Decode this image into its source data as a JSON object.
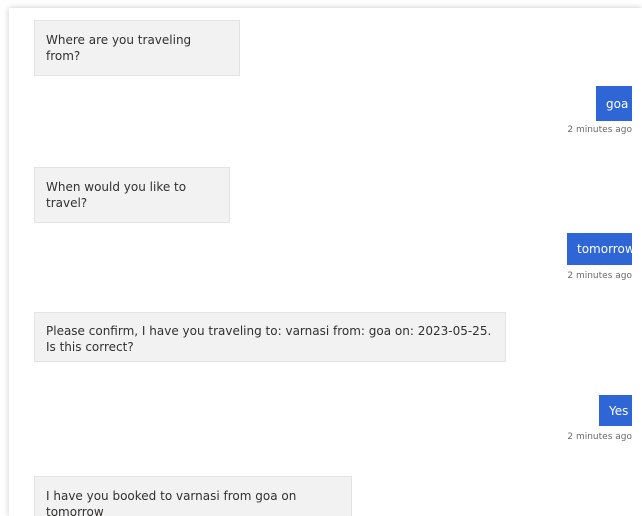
{
  "colors": {
    "user_bubble": "#2f66d6",
    "bot_bubble": "#f2f2f2",
    "timestamp": "#6b6b6b"
  },
  "messages": [
    {
      "from": "bot",
      "text": "Where are you traveling from?"
    },
    {
      "from": "user",
      "text": "goa",
      "time": "2 minutes ago"
    },
    {
      "from": "bot",
      "text": "When would you like to travel?"
    },
    {
      "from": "user",
      "text": "tomorrow",
      "time": "2 minutes ago"
    },
    {
      "from": "bot",
      "text": "Please confirm, I have you traveling to: varnasi from: goa on: 2023-05-25. Is this correct?"
    },
    {
      "from": "user",
      "text": "Yes",
      "time": "2 minutes ago"
    },
    {
      "from": "bot",
      "text": "I have you booked to varnasi from goa on tomorrow"
    }
  ]
}
